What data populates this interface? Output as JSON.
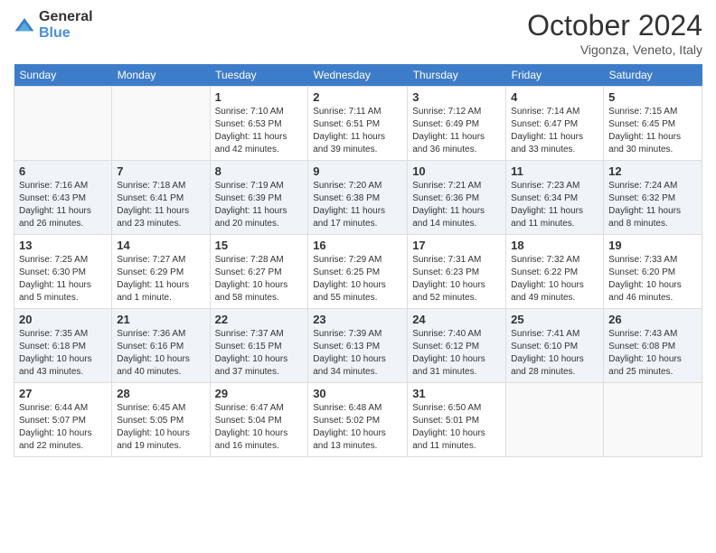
{
  "logo": {
    "general": "General",
    "blue": "Blue"
  },
  "header": {
    "month": "October 2024",
    "location": "Vigonza, Veneto, Italy"
  },
  "days_of_week": [
    "Sunday",
    "Monday",
    "Tuesday",
    "Wednesday",
    "Thursday",
    "Friday",
    "Saturday"
  ],
  "weeks": [
    [
      {
        "day": "",
        "info": ""
      },
      {
        "day": "",
        "info": ""
      },
      {
        "day": "1",
        "info": "Sunrise: 7:10 AM\nSunset: 6:53 PM\nDaylight: 11 hours and 42 minutes."
      },
      {
        "day": "2",
        "info": "Sunrise: 7:11 AM\nSunset: 6:51 PM\nDaylight: 11 hours and 39 minutes."
      },
      {
        "day": "3",
        "info": "Sunrise: 7:12 AM\nSunset: 6:49 PM\nDaylight: 11 hours and 36 minutes."
      },
      {
        "day": "4",
        "info": "Sunrise: 7:14 AM\nSunset: 6:47 PM\nDaylight: 11 hours and 33 minutes."
      },
      {
        "day": "5",
        "info": "Sunrise: 7:15 AM\nSunset: 6:45 PM\nDaylight: 11 hours and 30 minutes."
      }
    ],
    [
      {
        "day": "6",
        "info": "Sunrise: 7:16 AM\nSunset: 6:43 PM\nDaylight: 11 hours and 26 minutes."
      },
      {
        "day": "7",
        "info": "Sunrise: 7:18 AM\nSunset: 6:41 PM\nDaylight: 11 hours and 23 minutes."
      },
      {
        "day": "8",
        "info": "Sunrise: 7:19 AM\nSunset: 6:39 PM\nDaylight: 11 hours and 20 minutes."
      },
      {
        "day": "9",
        "info": "Sunrise: 7:20 AM\nSunset: 6:38 PM\nDaylight: 11 hours and 17 minutes."
      },
      {
        "day": "10",
        "info": "Sunrise: 7:21 AM\nSunset: 6:36 PM\nDaylight: 11 hours and 14 minutes."
      },
      {
        "day": "11",
        "info": "Sunrise: 7:23 AM\nSunset: 6:34 PM\nDaylight: 11 hours and 11 minutes."
      },
      {
        "day": "12",
        "info": "Sunrise: 7:24 AM\nSunset: 6:32 PM\nDaylight: 11 hours and 8 minutes."
      }
    ],
    [
      {
        "day": "13",
        "info": "Sunrise: 7:25 AM\nSunset: 6:30 PM\nDaylight: 11 hours and 5 minutes."
      },
      {
        "day": "14",
        "info": "Sunrise: 7:27 AM\nSunset: 6:29 PM\nDaylight: 11 hours and 1 minute."
      },
      {
        "day": "15",
        "info": "Sunrise: 7:28 AM\nSunset: 6:27 PM\nDaylight: 10 hours and 58 minutes."
      },
      {
        "day": "16",
        "info": "Sunrise: 7:29 AM\nSunset: 6:25 PM\nDaylight: 10 hours and 55 minutes."
      },
      {
        "day": "17",
        "info": "Sunrise: 7:31 AM\nSunset: 6:23 PM\nDaylight: 10 hours and 52 minutes."
      },
      {
        "day": "18",
        "info": "Sunrise: 7:32 AM\nSunset: 6:22 PM\nDaylight: 10 hours and 49 minutes."
      },
      {
        "day": "19",
        "info": "Sunrise: 7:33 AM\nSunset: 6:20 PM\nDaylight: 10 hours and 46 minutes."
      }
    ],
    [
      {
        "day": "20",
        "info": "Sunrise: 7:35 AM\nSunset: 6:18 PM\nDaylight: 10 hours and 43 minutes."
      },
      {
        "day": "21",
        "info": "Sunrise: 7:36 AM\nSunset: 6:16 PM\nDaylight: 10 hours and 40 minutes."
      },
      {
        "day": "22",
        "info": "Sunrise: 7:37 AM\nSunset: 6:15 PM\nDaylight: 10 hours and 37 minutes."
      },
      {
        "day": "23",
        "info": "Sunrise: 7:39 AM\nSunset: 6:13 PM\nDaylight: 10 hours and 34 minutes."
      },
      {
        "day": "24",
        "info": "Sunrise: 7:40 AM\nSunset: 6:12 PM\nDaylight: 10 hours and 31 minutes."
      },
      {
        "day": "25",
        "info": "Sunrise: 7:41 AM\nSunset: 6:10 PM\nDaylight: 10 hours and 28 minutes."
      },
      {
        "day": "26",
        "info": "Sunrise: 7:43 AM\nSunset: 6:08 PM\nDaylight: 10 hours and 25 minutes."
      }
    ],
    [
      {
        "day": "27",
        "info": "Sunrise: 6:44 AM\nSunset: 5:07 PM\nDaylight: 10 hours and 22 minutes."
      },
      {
        "day": "28",
        "info": "Sunrise: 6:45 AM\nSunset: 5:05 PM\nDaylight: 10 hours and 19 minutes."
      },
      {
        "day": "29",
        "info": "Sunrise: 6:47 AM\nSunset: 5:04 PM\nDaylight: 10 hours and 16 minutes."
      },
      {
        "day": "30",
        "info": "Sunrise: 6:48 AM\nSunset: 5:02 PM\nDaylight: 10 hours and 13 minutes."
      },
      {
        "day": "31",
        "info": "Sunrise: 6:50 AM\nSunset: 5:01 PM\nDaylight: 10 hours and 11 minutes."
      },
      {
        "day": "",
        "info": ""
      },
      {
        "day": "",
        "info": ""
      }
    ]
  ]
}
